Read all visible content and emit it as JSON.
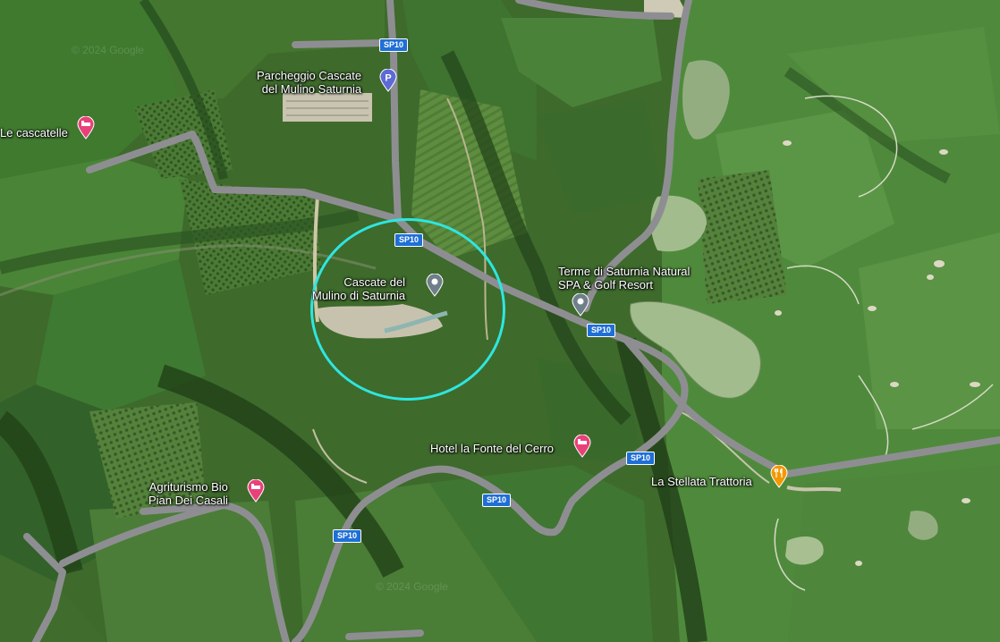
{
  "map": {
    "road_label": "SP10",
    "watermark": "© 2024 Google",
    "places": {
      "parking": "Parcheggio Cascate\ndel Mulino Saturnia",
      "cascatelle": "Le cascatelle",
      "cascate": "Cascate del\nMulino di Saturnia",
      "terme": "Terme di Saturnia Natural\nSPA & Golf Resort",
      "hotel": "Hotel la Fonte del Cerro",
      "agriturismo": "Agriturismo Bio\nPian Dei Casali",
      "stellata": "La Stellata Trattoria"
    },
    "colors": {
      "hotel_pin": "#e8417a",
      "parking_pin": "#5c6bd6",
      "restaurant_pin": "#f29900",
      "landmark_pin": "#6f7f8a",
      "highlight_circle": "#2ee6e0"
    }
  }
}
